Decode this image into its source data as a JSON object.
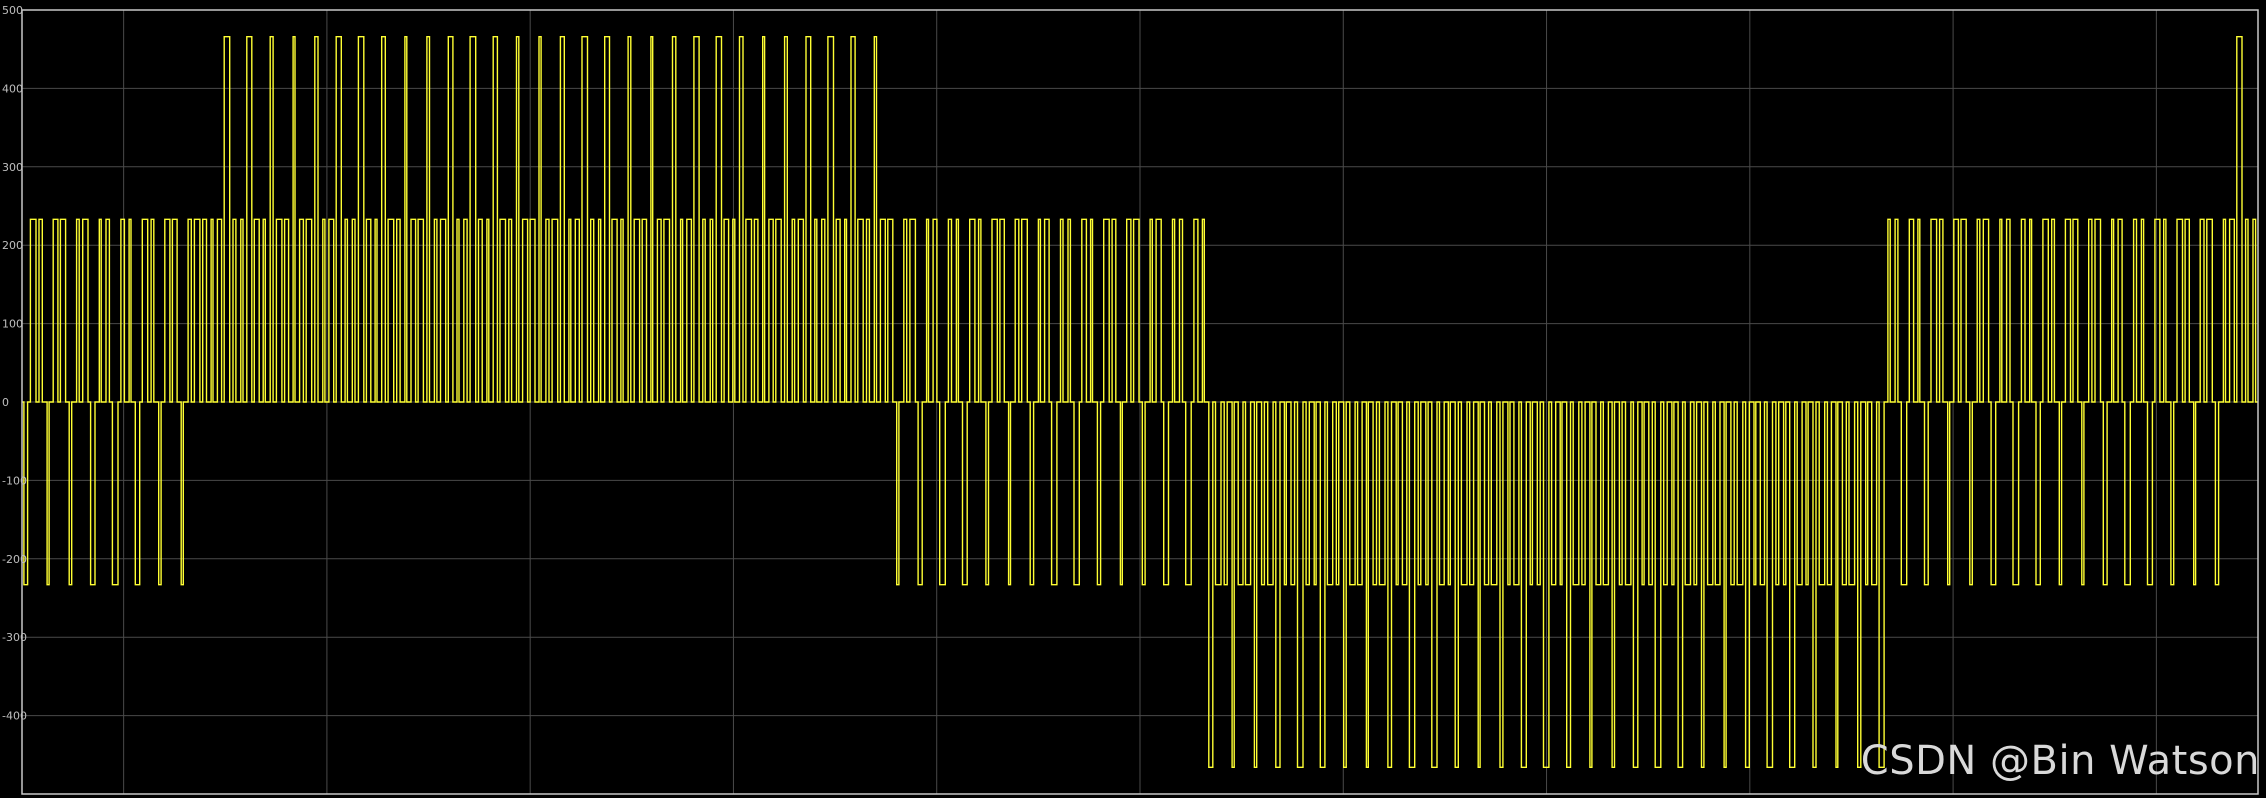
{
  "watermark": "CSDN @Bin Watson",
  "colors": {
    "background": "#000000",
    "axes_frame": "#c8c8c8",
    "grid": "#4a4a4a",
    "trace": "#ffff33",
    "tick_text": "#bfbfbf"
  },
  "chart_data": {
    "type": "line",
    "title": "",
    "xlabel": "",
    "ylabel": "",
    "grid": true,
    "ylim": [
      -500,
      500
    ],
    "yticks": [
      500,
      400,
      300,
      200,
      100,
      0,
      -100,
      -200,
      -300,
      -400
    ],
    "xlim": [
      0,
      1
    ],
    "x_gridlines": 11,
    "carrier_pulses": 300,
    "series": [
      {
        "values": [
          -466,
          -233,
          0,
          233,
          466
        ],
        "segments": [
          {
            "x_start": 0.0,
            "x_end": 0.073,
            "levels": [
              0,
              233,
              -233
            ]
          },
          {
            "x_start": 0.073,
            "x_end": 0.083,
            "levels": [
              0,
              233
            ]
          },
          {
            "x_start": 0.083,
            "x_end": 0.385,
            "levels": [
              0,
              233,
              466
            ]
          },
          {
            "x_start": 0.385,
            "x_end": 0.53,
            "levels": [
              0,
              233,
              -233
            ]
          },
          {
            "x_start": 0.53,
            "x_end": 0.835,
            "levels": [
              0,
              -233,
              -466
            ]
          },
          {
            "x_start": 0.835,
            "x_end": 0.985,
            "levels": [
              0,
              233,
              -233
            ]
          },
          {
            "x_start": 0.985,
            "x_end": 1.0,
            "levels": [
              0,
              233,
              466
            ]
          }
        ]
      }
    ]
  }
}
